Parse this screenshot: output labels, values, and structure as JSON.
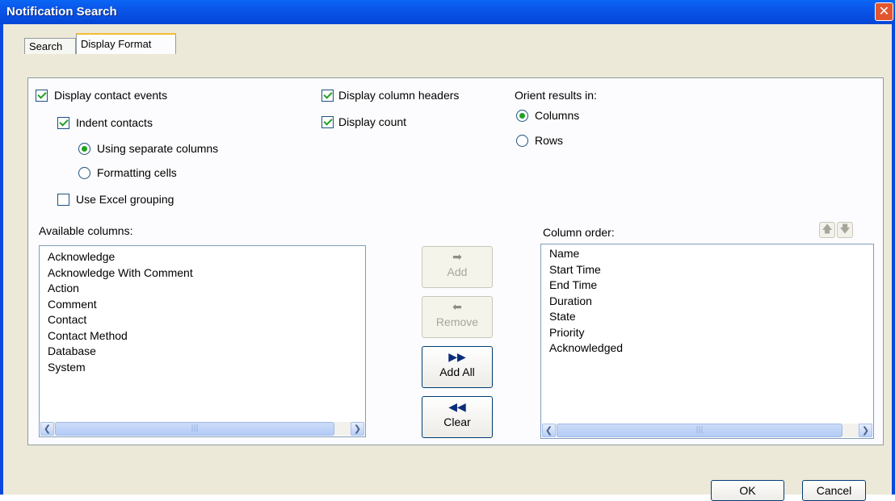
{
  "window": {
    "title": "Notification Search",
    "close_glyph": "✕"
  },
  "tabs": [
    {
      "label": "Search"
    },
    {
      "label": "Display Format"
    }
  ],
  "options": {
    "display_contact_events": {
      "label": "Display contact events",
      "checked": true
    },
    "indent_contacts": {
      "label": "Indent contacts",
      "checked": true
    },
    "using_separate_columns": {
      "label": "Using separate columns",
      "selected": true
    },
    "formatting_cells": {
      "label": "Formatting cells",
      "selected": false
    },
    "use_excel_grouping": {
      "label": "Use Excel grouping",
      "checked": false
    },
    "display_column_headers": {
      "label": "Display column headers",
      "checked": true
    },
    "display_count": {
      "label": "Display count",
      "checked": true
    },
    "orient_label": "Orient results in:",
    "orient_columns": {
      "label": "Columns",
      "selected": true
    },
    "orient_rows": {
      "label": "Rows",
      "selected": false
    }
  },
  "available": {
    "label": "Available columns:",
    "items": [
      "Acknowledge",
      "Acknowledge With Comment",
      "Action",
      "Comment",
      "Contact",
      "Contact Method",
      "Database",
      "System"
    ]
  },
  "order": {
    "label": "Column order:",
    "items": [
      "Name",
      "Start Time",
      "End Time",
      "Duration",
      "State",
      "Priority",
      "Acknowledged"
    ]
  },
  "buttons": {
    "add": {
      "label": "Add",
      "icon": "➡",
      "enabled": false
    },
    "remove": {
      "label": "Remove",
      "icon": "⬅",
      "enabled": false
    },
    "add_all": {
      "label": "Add All",
      "icon": "▶▶",
      "enabled": true
    },
    "clear": {
      "label": "Clear",
      "icon": "◀◀",
      "enabled": true
    },
    "move_up_icon": "🡅",
    "move_down_icon": "🡇",
    "ok": "OK",
    "cancel": "Cancel"
  },
  "scroll": {
    "left_glyph": "❮",
    "right_glyph": "❯",
    "thumb_glyph": "|||"
  }
}
